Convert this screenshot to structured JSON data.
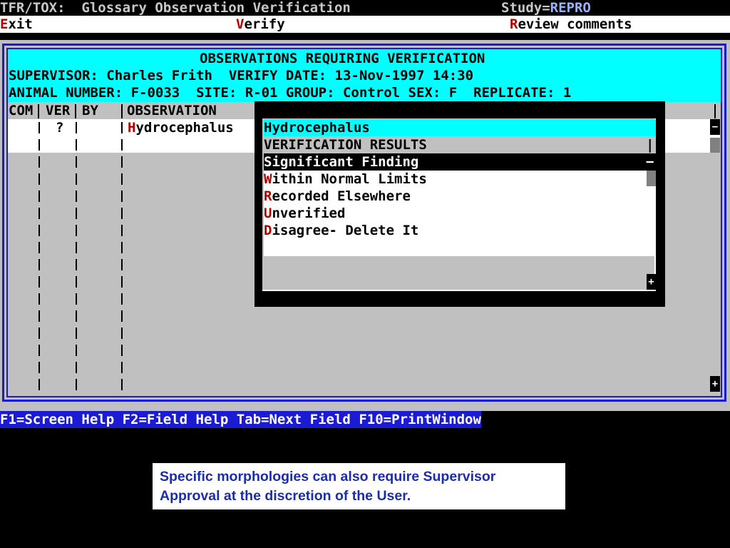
{
  "app_title": "TFR/TOX:  Glossary Observation Verification",
  "study_label": "Study=",
  "study_value": "REPRO",
  "colors": {
    "accent_cyan": "#00ffff",
    "frame_blue": "#1b1bd4",
    "hotkey_red": "#b00000",
    "caption_blue": "#1b2ea8"
  },
  "menu": {
    "exit": {
      "hotkey": "E",
      "rest": "xit"
    },
    "verify": {
      "hotkey": "V",
      "rest": "erify"
    },
    "review": {
      "hotkey": "R",
      "rest": "eview comments"
    }
  },
  "header": {
    "title": "OBSERVATIONS REQUIRING VERIFICATION",
    "supervisor_line": "SUPERVISOR: Charles Frith  VERIFY DATE: 13-Nov-1997 14:30",
    "animal_line": "ANIMAL NUMBER: F-0033  SITE: R-01 GROUP: Control SEX: F  REPLICATE: 1"
  },
  "table": {
    "columns": [
      "COM",
      "VER",
      "BY",
      "OBSERVATION"
    ],
    "row": {
      "ver": "?",
      "observation_hotkey": "H",
      "observation_rest": "ydrocephalus"
    }
  },
  "popup": {
    "selected_value": "Hydrocephalus",
    "heading": "VERIFICATION RESULTS",
    "highlighted": "Significant Finding",
    "options": [
      {
        "hotkey": "W",
        "rest": "ithin Normal Limits"
      },
      {
        "hotkey": "R",
        "rest": "ecorded Elsewhere"
      },
      {
        "hotkey": "U",
        "rest": "nverified"
      },
      {
        "hotkey": "D",
        "rest": "isagree- Delete It"
      }
    ]
  },
  "scroll_symbols": {
    "minus": "−",
    "plus": "+",
    "bar": "|"
  },
  "function_keys": "F1=Screen Help F2=Field Help Tab=Next Field F10=PrintWindow",
  "caption": "Specific morphologies can also require Supervisor Approval at the discretion of the User."
}
